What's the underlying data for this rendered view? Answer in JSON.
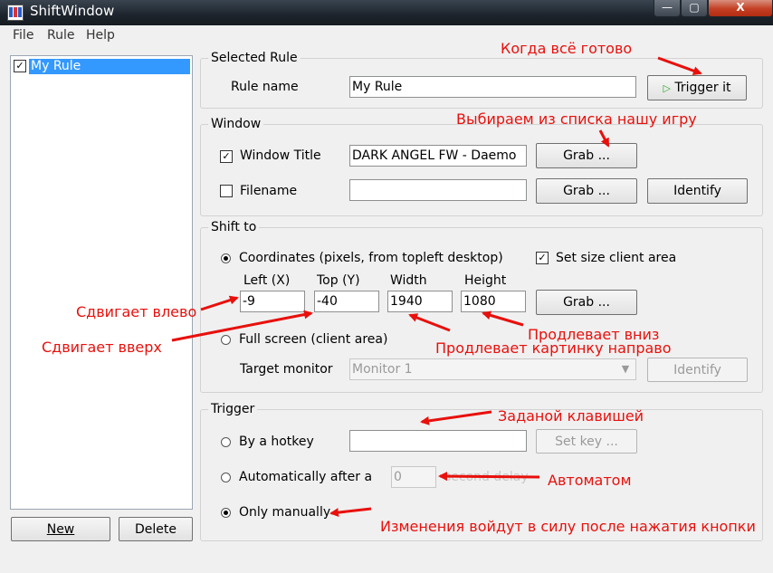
{
  "window": {
    "title": "ShiftWindow"
  },
  "title_buttons": {
    "minimize": "—",
    "maximize": "▢",
    "close": "X"
  },
  "menu": [
    "File",
    "Rule",
    "Help"
  ],
  "rules": {
    "items": [
      "My Rule"
    ],
    "new_label": "New",
    "delete_label": "Delete"
  },
  "selected_rule": {
    "legend": "Selected Rule",
    "name_label": "Rule name",
    "name_value": "My Rule",
    "trigger_label": "Trigger it"
  },
  "window_group": {
    "legend": "Window",
    "title_label": "Window Title",
    "title_checked": true,
    "title_value": "DARK ANGEL FW - Daemo",
    "filename_label": "Filename",
    "filename_checked": false,
    "filename_value": "",
    "grab1": "Grab ...",
    "grab2": "Grab ...",
    "identify": "Identify"
  },
  "shift_group": {
    "legend": "Shift to",
    "coords_label": "Coordinates (pixels, from topleft desktop)",
    "set_size_label": "Set size client area",
    "left_label": "Left (X)",
    "top_label": "Top (Y)",
    "width_label": "Width",
    "height_label": "Height",
    "left": "-9",
    "top": "-40",
    "width": "1940",
    "height": "1080",
    "grab": "Grab ...",
    "fullscreen_label": "Full screen (client area)",
    "monitor_label": "Target monitor",
    "monitor_value": "Monitor 1",
    "identify": "Identify"
  },
  "trigger_group": {
    "legend": "Trigger",
    "hotkey_label": "By a hotkey",
    "hotkey_value": "",
    "setkey": "Set key ...",
    "auto_label": "Automatically after a",
    "auto_value": "0",
    "auto_suffix": "second delay",
    "manual_label": "Only manually",
    "selected": "manual"
  },
  "annotations": {
    "when_ready": "Когда всё готово",
    "choose_game": "Выбираем из списка нашу игру",
    "shift_left": "Сдвигает влево",
    "shift_up": "Сдвигает вверх",
    "extend_down": "Продлевает вниз",
    "extend_right": "Продлевает картинку направо",
    "by_key": "Заданой клавишей",
    "auto": "Автоматом",
    "note": "Изменения войдут в силу после нажатия кнопки"
  },
  "colors": {
    "annotation": "#e8100c",
    "selection": "#3399ff",
    "titlebar": "#1d242c"
  }
}
